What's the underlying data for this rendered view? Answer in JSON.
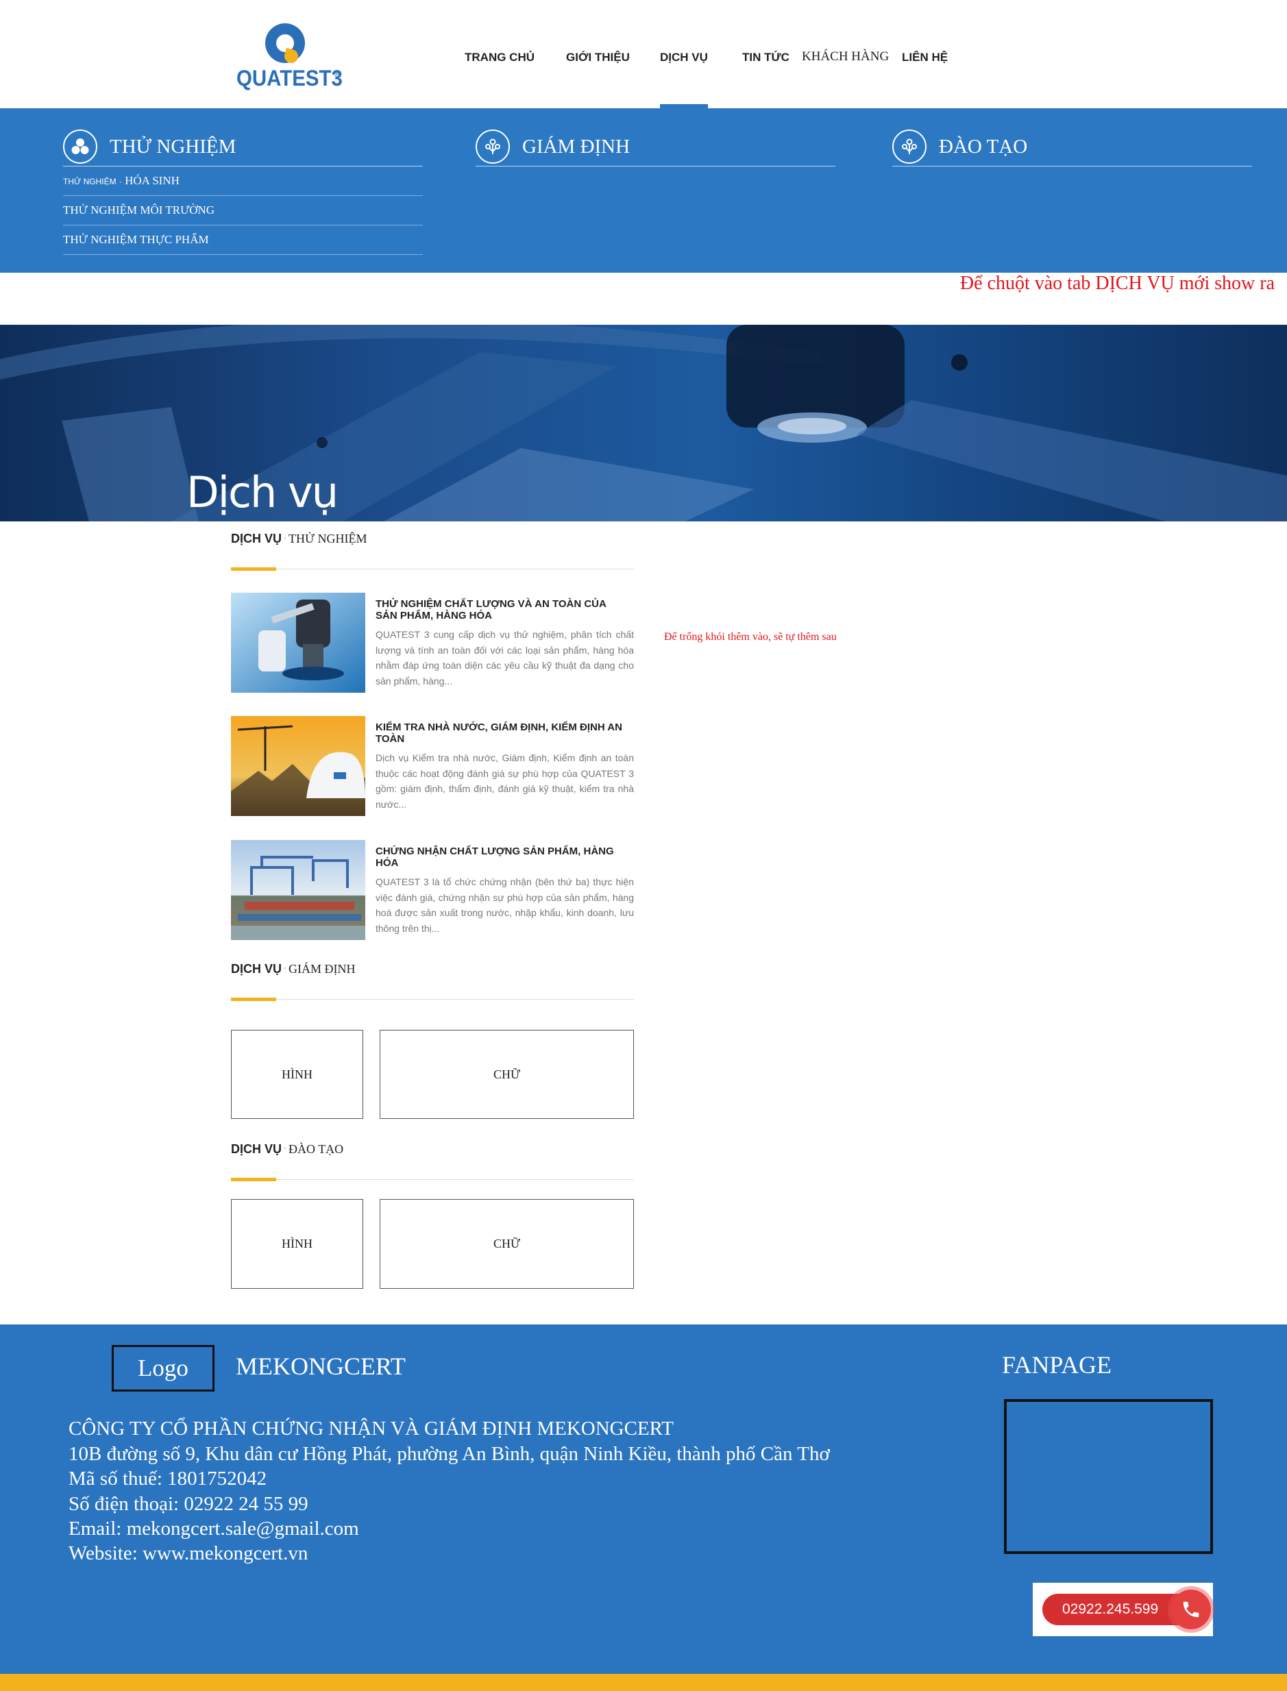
{
  "brand": {
    "logo_text": "QUATEST3",
    "registered": "®"
  },
  "nav": {
    "items": [
      {
        "label": "TRANG CHỦ"
      },
      {
        "label": "GIỚI THIỆU"
      },
      {
        "label": "DỊCH VỤ"
      },
      {
        "label": "TIN TỨC"
      },
      {
        "label": "KHÁCH HÀNG"
      },
      {
        "label": "LIÊN HỆ"
      }
    ],
    "active": "DỊCH VỤ"
  },
  "megamenu": {
    "columns": [
      {
        "title": "THỬ NGHIỆM",
        "links": [
          {
            "prefix": "THỬ NGHIỆM",
            "label": "HÓA SINH"
          },
          {
            "label": "THỬ NGHIỆM MÔI TRƯỜNG"
          },
          {
            "label": "THỬ NGHIỆM THỰC PHẨM"
          }
        ]
      },
      {
        "title": "GIÁM ĐỊNH",
        "links": []
      },
      {
        "title": "ĐÀO TẠO",
        "links": []
      }
    ]
  },
  "notes": {
    "hover": "Để chuột vào tab DỊCH VỤ mới show ra",
    "empty": "Để trống khói thêm vào, sẽ tự thêm sau"
  },
  "banner": {
    "title": "Dịch vụ"
  },
  "sections": [
    {
      "label": "DỊCH VỤ",
      "sub": "THỬ NGHIỆM"
    },
    {
      "label": "DỊCH VỤ",
      "sub": "GIÁM ĐỊNH"
    },
    {
      "label": "DỊCH VỤ",
      "sub": "ĐÀO TẠO"
    }
  ],
  "separator": "·",
  "articles": [
    {
      "title": "THỬ NGHIỆM CHẤT LƯỢNG VÀ AN TOÀN CỦA SẢN PHẨM, HÀNG HÓA",
      "desc": "QUATEST 3 cung cấp dịch vụ thử nghiệm, phân tích chất lượng và tính an toàn đối với các loại sản phẩm, hàng hóa nhằm đáp ứng toàn diện các yêu cầu kỹ thuật đa dạng cho sản phẩm, hàng..."
    },
    {
      "title": "KIỂM TRA NHÀ NƯỚC, GIÁM ĐỊNH, KIỂM ĐỊNH AN TOÀN",
      "desc": "Dịch vụ Kiểm tra nhà nước, Giám định, Kiểm định an toàn thuộc các hoạt động đánh giá sự phù hợp của QUATEST 3 gồm: giám định, thẩm định, đánh giá kỹ thuật, kiểm tra nhà nước..."
    },
    {
      "title": "CHỨNG NHẬN CHẤT LƯỢNG SẢN PHẨM, HÀNG HÓA",
      "desc": "QUATEST 3 là tổ chức chứng nhận (bên thứ ba) thực hiện việc đánh giá, chứng nhận sự phù hợp của sản phẩm, hàng hoá được sản xuất trong nước, nhập khẩu, kinh doanh, lưu thông trên thị..."
    }
  ],
  "placeholders": {
    "image": "HÌNH",
    "text": "CHỮ"
  },
  "footer": {
    "logo": "Logo",
    "brand": "MEKONGCERT",
    "fanpage": "FANPAGE",
    "company": "CÔNG TY CỔ PHẦN CHỨNG NHẬN VÀ GIÁM ĐỊNH MEKONGCERT",
    "address": "10B đường số 9, Khu dân cư Hồng Phát, phường An Bình, quận Ninh Kiều, thành phố Cần Thơ",
    "tax": "Mã số thuế: 1801752042",
    "phone": "Số điện thoại: 02922 24 55 99",
    "email": "Email: mekongcert.sale@gmail.com",
    "website": "Website: www.mekongcert.vn",
    "hotline": "02922.245.599"
  },
  "colors": {
    "primary": "#2c78c3",
    "accent": "#f3b21b",
    "note": "#e5141b"
  }
}
